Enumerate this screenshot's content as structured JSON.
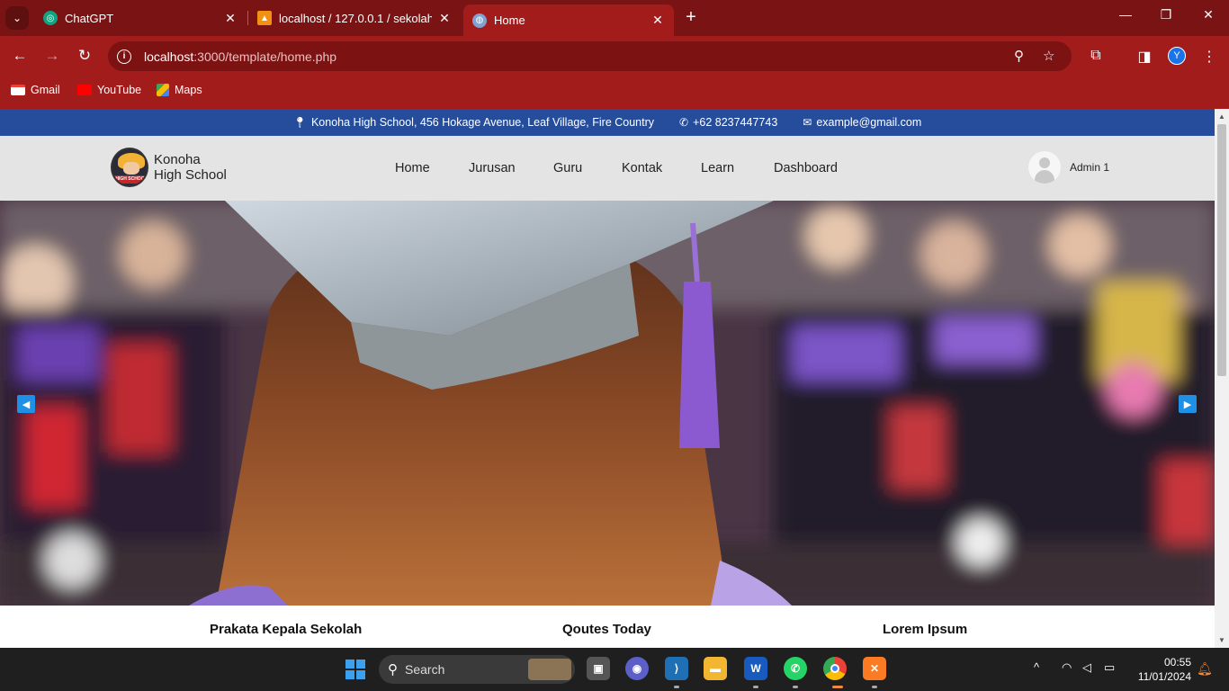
{
  "browser": {
    "tabs": [
      {
        "title": "ChatGPT",
        "favicon": "chatgpt-icon",
        "active": false
      },
      {
        "title": "localhost / 127.0.0.1 / sekolah /",
        "favicon": "phpmyadmin-icon",
        "active": false
      },
      {
        "title": "Home",
        "favicon": "globe-icon",
        "active": true
      }
    ],
    "address": {
      "host": "localhost",
      "path": ":3000/template/home.php"
    },
    "profile_initial": "Y",
    "bookmarks": [
      {
        "label": "Gmail",
        "icon": "gmail-icon"
      },
      {
        "label": "YouTube",
        "icon": "youtube-icon"
      },
      {
        "label": "Maps",
        "icon": "maps-icon"
      }
    ]
  },
  "site": {
    "topbar": {
      "address": "Konoha High School, 456 Hokage Avenue, Leaf Village, Fire Country",
      "phone": "+62 8237447743",
      "email": "example@gmail.com"
    },
    "brand": {
      "line1": "Konoha",
      "line2": "High School",
      "logo_text": "HIGH SCHOOL"
    },
    "nav": [
      "Home",
      "Jurusan",
      "Guru",
      "Kontak",
      "Learn",
      "Dashboard"
    ],
    "user": {
      "name": "Admin 1"
    },
    "sections": [
      "Prakata Kepala Sekolah",
      "Qoutes Today",
      "Lorem Ipsum"
    ]
  },
  "taskbar": {
    "search_placeholder": "Search",
    "time": "00:55",
    "date": "11/01/2024"
  },
  "colors": {
    "chrome_red": "#a31c1c",
    "tabbar_red": "#7a1414",
    "topbar_blue": "#264d9b",
    "nav_grey": "#e4e4e4",
    "slider_arrow": "#1e90e6"
  }
}
